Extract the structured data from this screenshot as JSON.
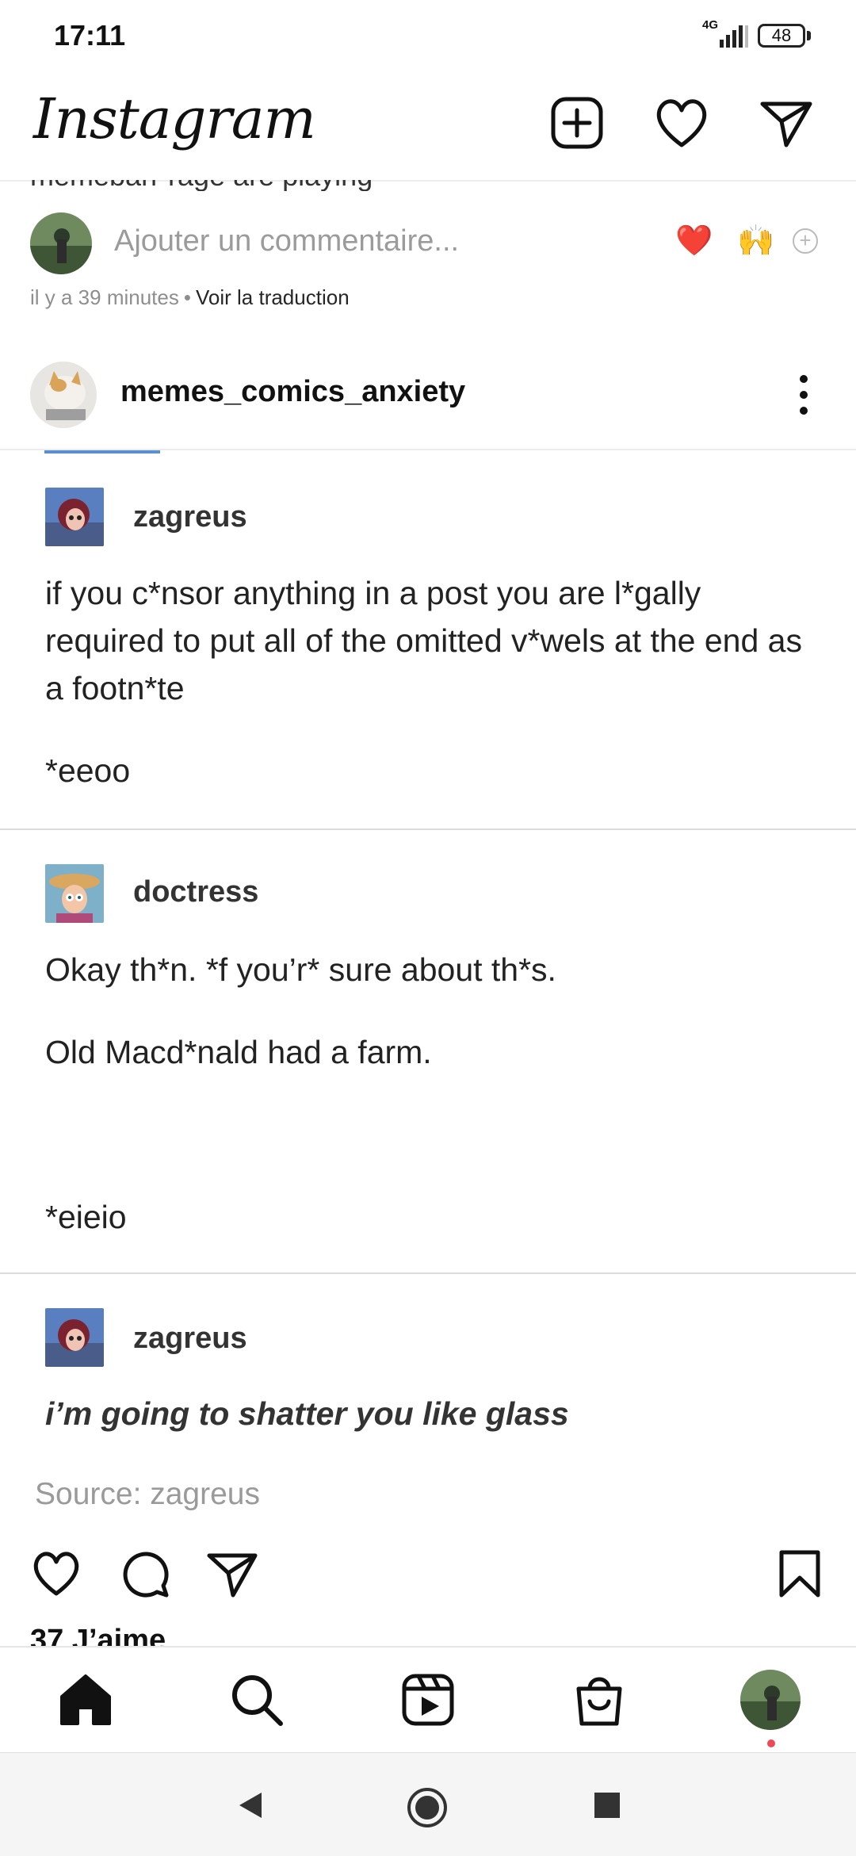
{
  "status_bar": {
    "time": "17:11",
    "network": "4G",
    "battery": "48"
  },
  "header": {
    "logo": "Instagram"
  },
  "previous_post": {
    "clipped_text": "memebarr rage are playing",
    "comment_placeholder": "Ajouter un commentaire...",
    "quick_reactions": [
      "❤️",
      "🙌"
    ],
    "time_ago": "il y a 39 minutes",
    "separator": "•",
    "translate": "Voir la traduction"
  },
  "post": {
    "username": "memes_comics_anxiety",
    "tumblr": [
      {
        "name": "zagreus",
        "lines": [
          "if you c*nsor anything in a post you are l*gally required to put all of the omitted v*wels at the end as a footn*te",
          "*eeoo"
        ]
      },
      {
        "name": "doctress",
        "lines": [
          "Okay th*n. *f you’r* sure about th*s.",
          "Old Macd*nald had a farm.",
          "*eieio"
        ]
      },
      {
        "name": "zagreus",
        "lines": [
          "i’m going to shatter you like glass"
        ]
      }
    ],
    "source": "Source: zagreus",
    "likes": "37 J’aime"
  },
  "colors": {
    "like_red": "#e0192d",
    "blue_accent": "#5a8fd0",
    "notification_dot": "#ed4956"
  },
  "icons": {
    "header": [
      "new-post-icon",
      "heart-icon",
      "direct-message-icon"
    ],
    "actions": [
      "like-icon",
      "comment-icon",
      "share-icon",
      "bookmark-icon"
    ],
    "nav": [
      "home-icon",
      "search-icon",
      "reels-icon",
      "shop-icon",
      "profile-avatar"
    ],
    "system": [
      "back-icon",
      "home-circle-icon",
      "recents-icon"
    ]
  }
}
